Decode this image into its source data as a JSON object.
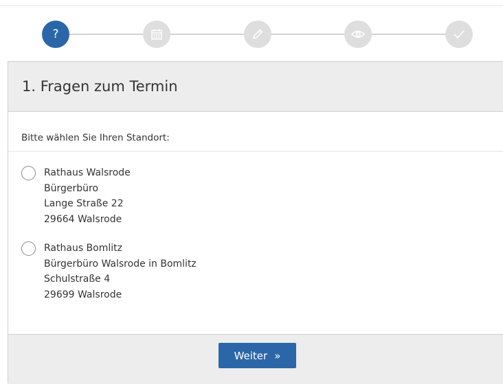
{
  "stepper": {
    "steps": [
      {
        "icon": "question-icon",
        "label": "?",
        "state": "active"
      },
      {
        "icon": "calendar-icon",
        "state": "inactive"
      },
      {
        "icon": "pencil-icon",
        "state": "inactive"
      },
      {
        "icon": "eye-icon",
        "state": "inactive"
      },
      {
        "icon": "checkmark-icon",
        "state": "inactive"
      }
    ],
    "active_color": "#2b67a8",
    "inactive_color": "#dedede"
  },
  "panel": {
    "title": "1. Fragen zum Termin",
    "prompt": "Bitte wählen Sie Ihren Standort:",
    "options": [
      {
        "name": "Rathaus Walsrode",
        "line2": "Bürgerbüro",
        "street": "Lange Straße 22",
        "city": "29664 Walsrode",
        "selected": false
      },
      {
        "name": "Rathaus Bomlitz",
        "line2": "Bürgerbüro Walsrode in Bomlitz",
        "street": "Schulstraße 4",
        "city": "29699 Walsrode",
        "selected": false
      }
    ]
  },
  "footer": {
    "next_label": "Weiter",
    "next_arrow": "»",
    "button_color": "#2b67a8"
  }
}
